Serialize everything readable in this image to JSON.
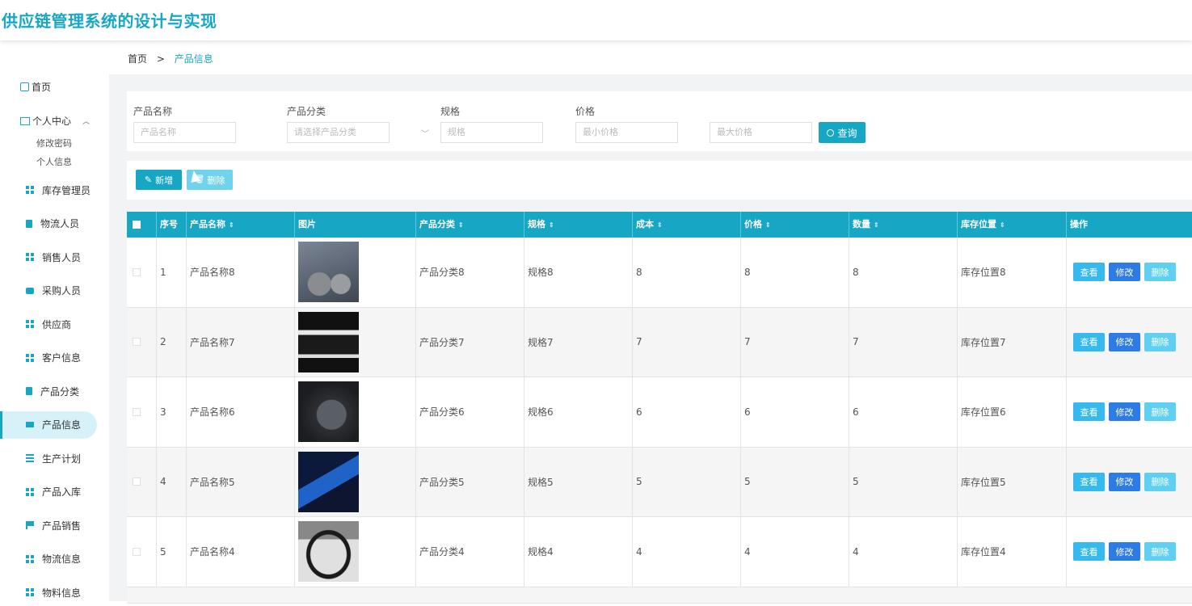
{
  "app": {
    "title": "供应链管理系统的设计与实现"
  },
  "breadcrumb": {
    "home": "首页",
    "separator": ">",
    "current": "产品信息"
  },
  "sidebar": {
    "home": "首页",
    "personal_center": {
      "label": "个人中心",
      "children": [
        "修改密码",
        "个人信息"
      ]
    },
    "items": [
      {
        "label": "库存管理员",
        "icon": "grid-icon"
      },
      {
        "label": "物流人员",
        "icon": "clipboard-icon"
      },
      {
        "label": "销售人员",
        "icon": "grid-icon"
      },
      {
        "label": "采购人员",
        "icon": "briefcase-icon"
      },
      {
        "label": "供应商",
        "icon": "grid-icon"
      },
      {
        "label": "客户信息",
        "icon": "grid-icon"
      },
      {
        "label": "产品分类",
        "icon": "clipboard-icon"
      },
      {
        "label": "产品信息",
        "icon": "monitor-icon",
        "active": true
      },
      {
        "label": "生产计划",
        "icon": "list-icon"
      },
      {
        "label": "产品入库",
        "icon": "grid-icon"
      },
      {
        "label": "产品销售",
        "icon": "flag-icon"
      },
      {
        "label": "物流信息",
        "icon": "grid-icon"
      },
      {
        "label": "物料信息",
        "icon": "grid-icon"
      }
    ]
  },
  "search": {
    "name_label": "产品名称",
    "name_placeholder": "产品名称",
    "category_label": "产品分类",
    "category_placeholder": "请选择产品分类",
    "spec_label": "规格",
    "spec_placeholder": "规格",
    "price_label": "价格",
    "min_price_placeholder": "最小价格",
    "max_price_placeholder": "最大价格",
    "query_button": "查询"
  },
  "actions": {
    "add": "新增",
    "delete": "删除"
  },
  "table": {
    "headers": [
      "序号",
      "产品名称",
      "图片",
      "产品分类",
      "规格",
      "成本",
      "价格",
      "数量",
      "库存位置",
      "操作"
    ],
    "row_actions": {
      "view": "查看",
      "edit": "修改",
      "delete": "删除"
    },
    "rows": [
      {
        "no": "1",
        "name": "产品名称8",
        "category": "产品分类8",
        "spec": "规格8",
        "cost": "8",
        "price": "8",
        "qty": "8",
        "location": "库存位置8",
        "image": "headphones"
      },
      {
        "no": "2",
        "name": "产品名称7",
        "category": "产品分类7",
        "spec": "规格7",
        "cost": "7",
        "price": "7",
        "qty": "7",
        "location": "库存位置7",
        "image": "smartwatch"
      },
      {
        "no": "3",
        "name": "产品名称6",
        "category": "产品分类6",
        "spec": "规格6",
        "cost": "6",
        "price": "6",
        "qty": "6",
        "location": "库存位置6",
        "image": "watch"
      },
      {
        "no": "4",
        "name": "产品名称5",
        "category": "产品分类5",
        "spec": "规格5",
        "cost": "5",
        "price": "5",
        "qty": "5",
        "location": "库存位置5",
        "image": "devices"
      },
      {
        "no": "5",
        "name": "产品名称4",
        "category": "产品分类4",
        "spec": "规格4",
        "cost": "4",
        "price": "4",
        "qty": "4",
        "location": "库存位置4",
        "image": "earphones"
      }
    ]
  },
  "colors": {
    "accent": "#17a7c4",
    "view": "#36b9ee",
    "edit": "#2d7be5",
    "delete": "#5fd0f2"
  }
}
